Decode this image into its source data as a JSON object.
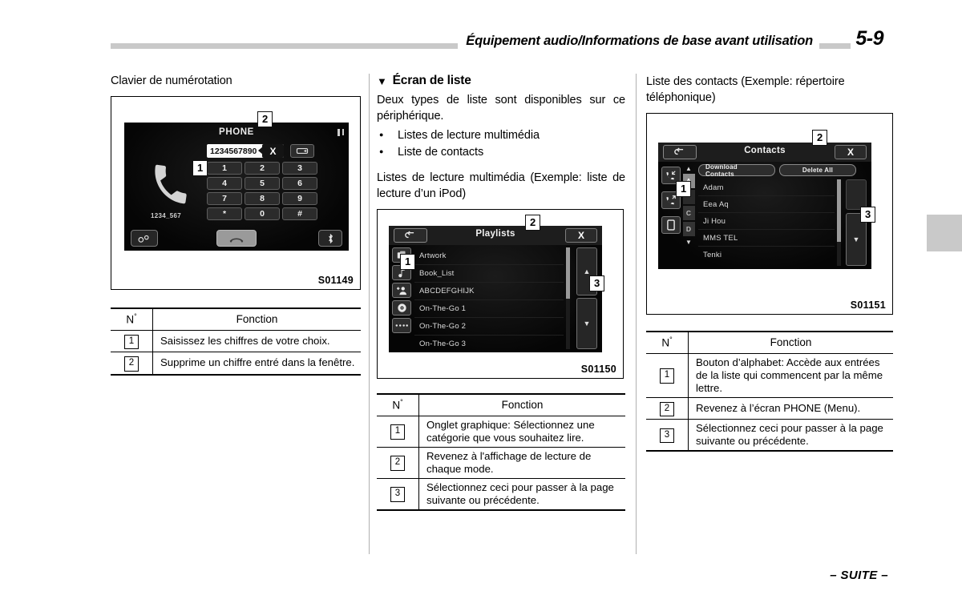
{
  "header": {
    "title": "Équipement audio/Informations de base avant utilisation",
    "page_number": "5-9"
  },
  "footer": {
    "suite": "– SUITE –"
  },
  "left_column": {
    "heading": "Clavier de numérotation",
    "figure_code": "S01149",
    "screen": {
      "title": "PHONE",
      "entry_value": "1234567890",
      "delete_label": "X",
      "redial_icon": "redial-icon",
      "keys": [
        "1",
        "2",
        "3",
        "4",
        "5",
        "6",
        "7",
        "8",
        "9",
        "*",
        "0",
        "#"
      ],
      "sub_number": "1234_567",
      "handset_icon": "handset-icon",
      "bottom_buttons": [
        {
          "name": "settings-button",
          "icon": "settings-icon"
        },
        {
          "name": "call-button",
          "icon": "call-handset-icon"
        },
        {
          "name": "bluetooth-button",
          "icon": "bluetooth-icon"
        }
      ],
      "callouts": [
        {
          "label": "1"
        },
        {
          "label": "2"
        }
      ]
    },
    "table": {
      "col1_header": "N",
      "col1_header_sym": "°",
      "col2_header": "Fonction",
      "rows": [
        {
          "num": "1",
          "text": "Saisissez les chiffres de votre choix."
        },
        {
          "num": "2",
          "text": "Supprime un chiffre entré dans la fenêtre."
        }
      ]
    }
  },
  "mid_column": {
    "heading": "Écran de liste",
    "intro": "Deux types de liste sont disponibles sur ce périphérique.",
    "bullets": [
      "Listes de lecture multimédia",
      "Liste de contacts"
    ],
    "subheading": "Listes de lecture multimédia (Exemple: liste de lecture d’un iPod)",
    "figure_code": "S01150",
    "screen": {
      "back_icon": "back-arrow-icon",
      "title": "Playlists",
      "close_label": "X",
      "side_tabs": [
        {
          "name": "playlist-tab",
          "icon": "stacked-squares-icon"
        },
        {
          "name": "songs-tab",
          "icon": "music-note-icon"
        },
        {
          "name": "artists-tab",
          "icon": "person-icon"
        },
        {
          "name": "albums-tab",
          "icon": "disc-icon"
        },
        {
          "name": "more-tab",
          "icon": "dots-icon"
        }
      ],
      "rows": [
        "Artwork",
        "Book_List",
        "ABCDEFGHIJK",
        "On-The-Go 1",
        "On-The-Go 2",
        "On-The-Go 3"
      ],
      "pager_up": "▲",
      "pager_down": "▼",
      "callouts": [
        {
          "label": "1"
        },
        {
          "label": "2"
        },
        {
          "label": "3"
        }
      ]
    },
    "table": {
      "col1_header": "N",
      "col1_header_sym": "°",
      "col2_header": "Fonction",
      "rows": [
        {
          "num": "1",
          "text": "Onglet graphique: Sélectionnez une catégorie que vous souhaitez lire."
        },
        {
          "num": "2",
          "text": "Revenez à l'affichage de lecture de chaque mode."
        },
        {
          "num": "3",
          "text": "Sélectionnez ceci pour passer à la page suivante ou précédente."
        }
      ]
    }
  },
  "right_column": {
    "heading": "Liste des contacts (Exemple: répertoire téléphonique)",
    "figure_code": "S01151",
    "screen": {
      "back_icon": "back-arrow-icon",
      "title": "Contacts",
      "close_label": "X",
      "side_tabs": [
        {
          "name": "incoming-calls-tab",
          "icon": "incoming-call-icon"
        },
        {
          "name": "outgoing-calls-tab",
          "icon": "outgoing-call-icon"
        },
        {
          "name": "device-tab",
          "icon": "phone-device-icon"
        }
      ],
      "actions": [
        "Download Contacts",
        "Delete All"
      ],
      "alpha_up": "▲",
      "alpha_down": "▼",
      "alpha_items": [
        "A",
        "C",
        "D"
      ],
      "rows": [
        "Adam",
        "Eea Aq",
        "Ji Hou",
        "MMS TEL",
        "Tenki"
      ],
      "pager_down": "▼",
      "callouts": [
        {
          "label": "1"
        },
        {
          "label": "2"
        },
        {
          "label": "3"
        }
      ]
    },
    "table": {
      "col1_header": "N",
      "col1_header_sym": "°",
      "col2_header": "Fonction",
      "rows": [
        {
          "num": "1",
          "text": "Bouton d’alphabet: Accède aux entrées de la liste qui commencent par la même lettre."
        },
        {
          "num": "2",
          "text": "Revenez à l’écran PHONE (Menu)."
        },
        {
          "num": "3",
          "text": "Sélectionnez ceci pour passer à la page suivante ou précédente."
        }
      ]
    }
  }
}
